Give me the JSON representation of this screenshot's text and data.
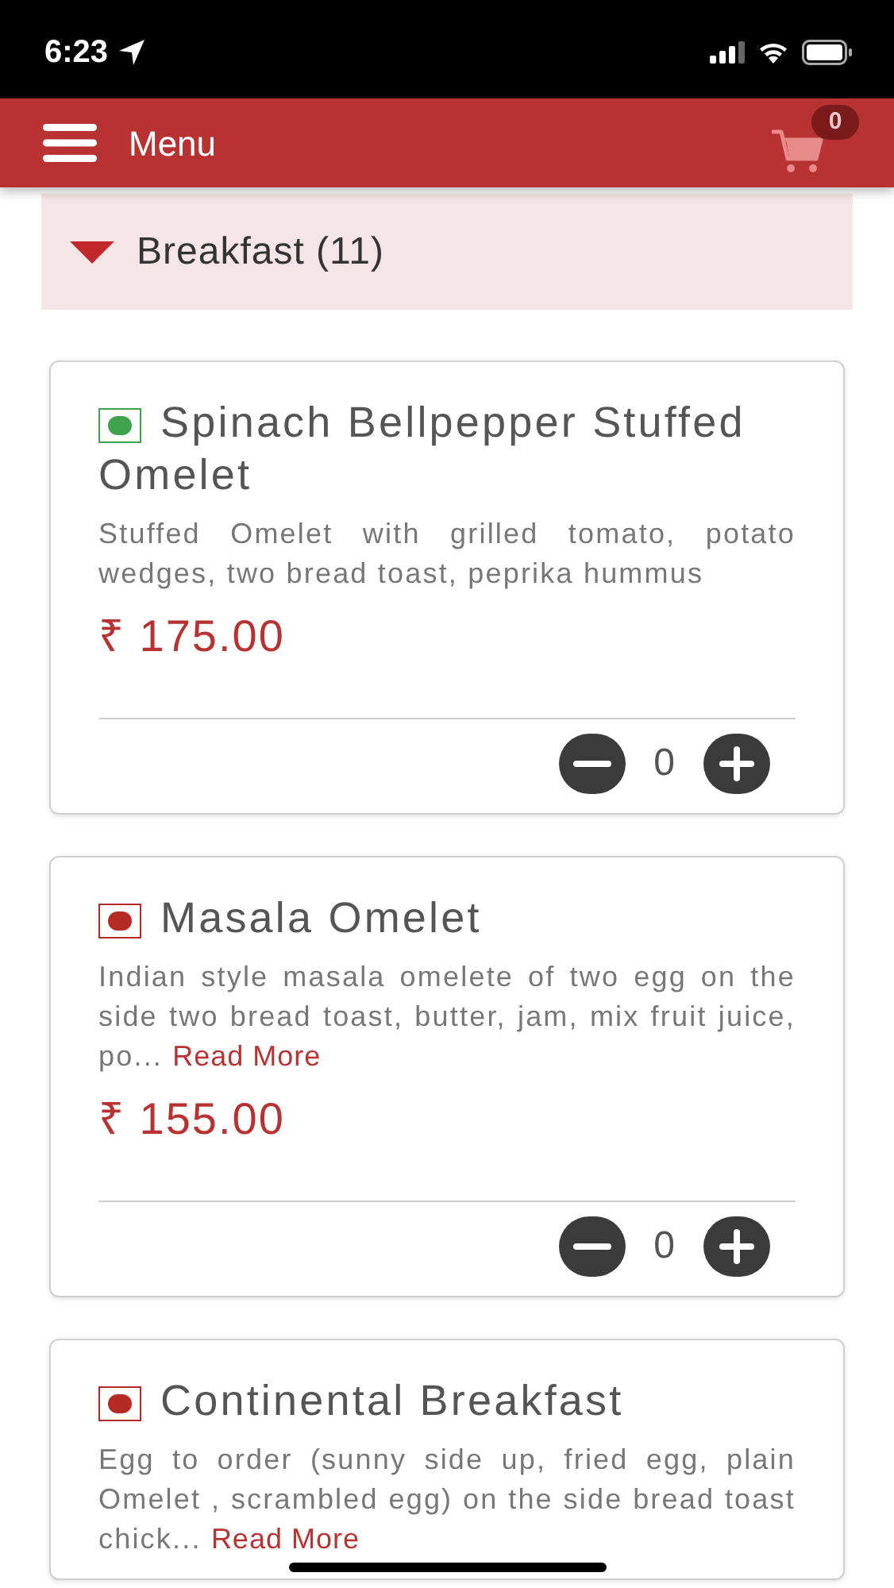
{
  "status_bar": {
    "time": "6:23"
  },
  "header": {
    "title": "Menu",
    "cart_count": "0"
  },
  "category": {
    "title": "Breakfast (11)",
    "expanded": true
  },
  "items": [
    {
      "name": "Spinach Bellpepper Stuffed Omelet",
      "veg": true,
      "description": "Stuffed Omelet with grilled tomato, potato wedges, two bread toast, peprika hummus",
      "price": "₹ 175.00",
      "quantity": "0"
    },
    {
      "name": "Masala Omelet",
      "veg": false,
      "description": "Indian style masala omelete of two egg on the side two bread toast, butter, jam, mix fruit juice, po...",
      "read_more": "Read More",
      "price": "₹ 155.00",
      "quantity": "0"
    },
    {
      "name": "Continental Breakfast",
      "veg": false,
      "description": "Egg to order (sunny side up, fried egg, plain Omelet , scrambled egg) on the side bread toast chick...",
      "read_more": "Read More"
    }
  ]
}
